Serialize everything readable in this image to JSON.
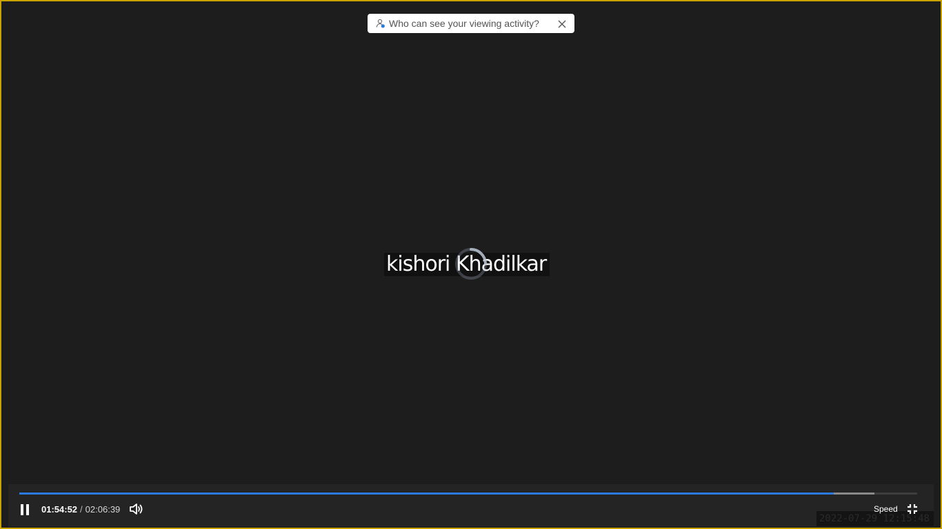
{
  "notice": {
    "text": "Who can see your viewing activity?",
    "icon": "user-visibility-icon",
    "close_icon": "close-icon"
  },
  "watermark": {
    "name": "kishori Khadilkar"
  },
  "player": {
    "current_time": "01:54:52",
    "separator": "/",
    "total_time": "02:06:39",
    "played_fraction": 0.907,
    "buffered_fraction": 0.952,
    "speed_label": "Speed",
    "timestamp": "2022-07-29  12:15:48",
    "accent_color": "#2b79e3",
    "frame_border_color": "#c9a400",
    "icons": {
      "pause": "pause-icon",
      "volume": "volume-icon",
      "exit_fullscreen": "exit-fullscreen-icon",
      "loading": "loading-spinner-icon"
    }
  }
}
